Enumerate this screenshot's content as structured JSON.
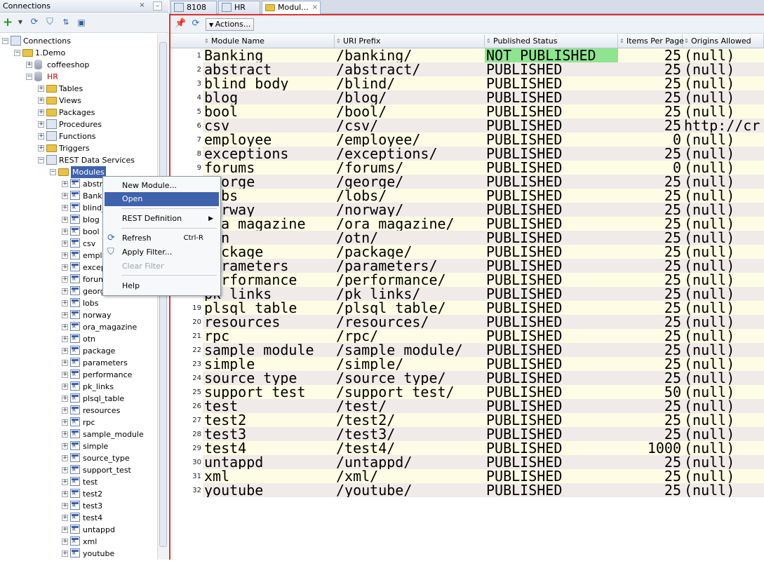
{
  "connections_panel": {
    "title": "Connections",
    "tree": [
      {
        "label": "Connections",
        "level": 0,
        "icon": "connections-icon",
        "expander": "minus"
      },
      {
        "label": "1.Demo",
        "level": 1,
        "icon": "folder-icon",
        "expander": "minus"
      },
      {
        "label": "coffeeshop",
        "level": 2,
        "icon": "database-icon",
        "expander": "plus"
      },
      {
        "label": "HR",
        "level": 2,
        "icon": "database-icon",
        "expander": "minus",
        "color": "#cc0000"
      },
      {
        "label": "Tables",
        "level": 3,
        "icon": "tables-icon",
        "expander": "plus"
      },
      {
        "label": "Views",
        "level": 3,
        "icon": "views-icon",
        "expander": "plus"
      },
      {
        "label": "Packages",
        "level": 3,
        "icon": "packages-icon",
        "expander": "plus"
      },
      {
        "label": "Procedures",
        "level": 3,
        "icon": "procedures-icon",
        "expander": "plus"
      },
      {
        "label": "Functions",
        "level": 3,
        "icon": "functions-icon",
        "expander": "plus"
      },
      {
        "label": "Triggers",
        "level": 3,
        "icon": "triggers-icon",
        "expander": "plus"
      },
      {
        "label": "REST Data Services",
        "level": 3,
        "icon": "rest-data-services-icon",
        "expander": "minus"
      },
      {
        "label": "Modules",
        "level": 4,
        "icon": "modules-icon",
        "expander": "minus",
        "selected": true
      },
      {
        "label": "abstra",
        "level": 5,
        "icon": "rest-module-icon",
        "expander": "plus"
      },
      {
        "label": "Bankir",
        "level": 5,
        "icon": "rest-module-icon",
        "expander": "plus"
      },
      {
        "label": "blind_",
        "level": 5,
        "icon": "rest-module-icon",
        "expander": "plus"
      },
      {
        "label": "blog",
        "level": 5,
        "icon": "rest-module-icon",
        "expander": "plus"
      },
      {
        "label": "bool",
        "level": 5,
        "icon": "rest-module-icon",
        "expander": "plus"
      },
      {
        "label": "csv",
        "level": 5,
        "icon": "rest-module-icon",
        "expander": "plus"
      },
      {
        "label": "emplo",
        "level": 5,
        "icon": "rest-module-icon",
        "expander": "plus"
      },
      {
        "label": "excep",
        "level": 5,
        "icon": "rest-module-icon",
        "expander": "plus"
      },
      {
        "label": "forum",
        "level": 5,
        "icon": "rest-module-icon",
        "expander": "plus"
      },
      {
        "label": "georg",
        "level": 5,
        "icon": "rest-module-icon",
        "expander": "plus"
      },
      {
        "label": "lobs",
        "level": 5,
        "icon": "rest-module-icon",
        "expander": "plus"
      },
      {
        "label": "norway",
        "level": 5,
        "icon": "rest-module-icon",
        "expander": "plus"
      },
      {
        "label": "ora_magazine",
        "level": 5,
        "icon": "rest-module-icon",
        "expander": "plus"
      },
      {
        "label": "otn",
        "level": 5,
        "icon": "rest-module-icon",
        "expander": "plus"
      },
      {
        "label": "package",
        "level": 5,
        "icon": "rest-module-icon",
        "expander": "plus"
      },
      {
        "label": "parameters",
        "level": 5,
        "icon": "rest-module-icon",
        "expander": "plus"
      },
      {
        "label": "performance",
        "level": 5,
        "icon": "rest-module-icon",
        "expander": "plus"
      },
      {
        "label": "pk_links",
        "level": 5,
        "icon": "rest-module-icon",
        "expander": "plus"
      },
      {
        "label": "plsql_table",
        "level": 5,
        "icon": "rest-module-icon",
        "expander": "plus"
      },
      {
        "label": "resources",
        "level": 5,
        "icon": "rest-module-icon",
        "expander": "plus"
      },
      {
        "label": "rpc",
        "level": 5,
        "icon": "rest-module-icon",
        "expander": "plus"
      },
      {
        "label": "sample_module",
        "level": 5,
        "icon": "rest-module-icon",
        "expander": "plus"
      },
      {
        "label": "simple",
        "level": 5,
        "icon": "rest-module-icon",
        "expander": "plus"
      },
      {
        "label": "source_type",
        "level": 5,
        "icon": "rest-module-icon",
        "expander": "plus"
      },
      {
        "label": "support_test",
        "level": 5,
        "icon": "rest-module-icon",
        "expander": "plus"
      },
      {
        "label": "test",
        "level": 5,
        "icon": "rest-module-icon",
        "expander": "plus"
      },
      {
        "label": "test2",
        "level": 5,
        "icon": "rest-module-icon",
        "expander": "plus"
      },
      {
        "label": "test3",
        "level": 5,
        "icon": "rest-module-icon",
        "expander": "plus"
      },
      {
        "label": "test4",
        "level": 5,
        "icon": "rest-module-icon",
        "expander": "plus"
      },
      {
        "label": "untappd",
        "level": 5,
        "icon": "rest-module-icon",
        "expander": "plus"
      },
      {
        "label": "xml",
        "level": 5,
        "icon": "rest-module-icon",
        "expander": "plus"
      },
      {
        "label": "youtube",
        "level": 5,
        "icon": "rest-module-icon",
        "expander": "plus"
      }
    ]
  },
  "tabs": [
    {
      "label": "8108",
      "icon": "sql-worksheet-icon",
      "active": false
    },
    {
      "label": "HR",
      "icon": "sql-worksheet-icon",
      "active": false
    },
    {
      "label": "Modul...",
      "icon": "modules-icon",
      "active": true
    }
  ],
  "editor_toolbar": {
    "actions_label": "Actions..."
  },
  "grid": {
    "columns": [
      "Module Name",
      "URI Prefix",
      "Published Status",
      "Items Per Page",
      "Origins Allowed"
    ],
    "rows": [
      {
        "n": "1",
        "name": "Banking",
        "uri": "/banking/",
        "status": "NOT PUBLISHED",
        "items": "25",
        "origins": "(null)"
      },
      {
        "n": "2",
        "name": "abstract",
        "uri": "/abstract/",
        "status": "PUBLISHED",
        "items": "25",
        "origins": "(null)"
      },
      {
        "n": "3",
        "name": "blind body",
        "uri": "/blind/",
        "status": "PUBLISHED",
        "items": "25",
        "origins": "(null)"
      },
      {
        "n": "4",
        "name": "blog",
        "uri": "/blog/",
        "status": "PUBLISHED",
        "items": "25",
        "origins": "(null)"
      },
      {
        "n": "5",
        "name": "bool",
        "uri": "/bool/",
        "status": "PUBLISHED",
        "items": "25",
        "origins": "(null)"
      },
      {
        "n": "6",
        "name": "csv",
        "uri": "/csv/",
        "status": "PUBLISHED",
        "items": "25",
        "origins": "http://cr"
      },
      {
        "n": "7",
        "name": "employee",
        "uri": "/employee/",
        "status": "PUBLISHED",
        "items": "0",
        "origins": "(null)"
      },
      {
        "n": "8",
        "name": "exceptions",
        "uri": "/exceptions/",
        "status": "PUBLISHED",
        "items": "25",
        "origins": "(null)"
      },
      {
        "n": "9",
        "name": "forums",
        "uri": "/forums/",
        "status": "PUBLISHED",
        "items": "0",
        "origins": "(null)"
      },
      {
        "n": "10",
        "name": "george",
        "uri": "/george/",
        "status": "PUBLISHED",
        "items": "25",
        "origins": "(null)"
      },
      {
        "n": "11",
        "name": "lobs",
        "uri": "/lobs/",
        "status": "PUBLISHED",
        "items": "25",
        "origins": "(null)"
      },
      {
        "n": "12",
        "name": "norway",
        "uri": "/norway/",
        "status": "PUBLISHED",
        "items": "25",
        "origins": "(null)"
      },
      {
        "n": "13",
        "name": "ora magazine",
        "uri": "/ora magazine/",
        "status": "PUBLISHED",
        "items": "25",
        "origins": "(null)"
      },
      {
        "n": "14",
        "name": "otn",
        "uri": "/otn/",
        "status": "PUBLISHED",
        "items": "25",
        "origins": "(null)"
      },
      {
        "n": "15",
        "name": "package",
        "uri": "/package/",
        "status": "PUBLISHED",
        "items": "25",
        "origins": "(null)"
      },
      {
        "n": "16",
        "name": "parameters",
        "uri": "/parameters/",
        "status": "PUBLISHED",
        "items": "25",
        "origins": "(null)"
      },
      {
        "n": "17",
        "name": "performance",
        "uri": "/performance/",
        "status": "PUBLISHED",
        "items": "25",
        "origins": "(null)"
      },
      {
        "n": "18",
        "name": "pk links",
        "uri": "/pk links/",
        "status": "PUBLISHED",
        "items": "25",
        "origins": "(null)"
      },
      {
        "n": "19",
        "name": "plsql table",
        "uri": "/plsql table/",
        "status": "PUBLISHED",
        "items": "25",
        "origins": "(null)"
      },
      {
        "n": "20",
        "name": "resources",
        "uri": "/resources/",
        "status": "PUBLISHED",
        "items": "25",
        "origins": "(null)"
      },
      {
        "n": "21",
        "name": "rpc",
        "uri": "/rpc/",
        "status": "PUBLISHED",
        "items": "25",
        "origins": "(null)"
      },
      {
        "n": "22",
        "name": "sample module",
        "uri": "/sample module/",
        "status": "PUBLISHED",
        "items": "25",
        "origins": "(null)"
      },
      {
        "n": "23",
        "name": "simple",
        "uri": "/simple/",
        "status": "PUBLISHED",
        "items": "25",
        "origins": "(null)"
      },
      {
        "n": "24",
        "name": "source type",
        "uri": "/source type/",
        "status": "PUBLISHED",
        "items": "25",
        "origins": "(null)"
      },
      {
        "n": "25",
        "name": "support test",
        "uri": "/support test/",
        "status": "PUBLISHED",
        "items": "50",
        "origins": "(null)"
      },
      {
        "n": "26",
        "name": "test",
        "uri": "/test/",
        "status": "PUBLISHED",
        "items": "25",
        "origins": "(null)"
      },
      {
        "n": "27",
        "name": "test2",
        "uri": "/test2/",
        "status": "PUBLISHED",
        "items": "25",
        "origins": "(null)"
      },
      {
        "n": "28",
        "name": "test3",
        "uri": "/test3/",
        "status": "PUBLISHED",
        "items": "25",
        "origins": "(null)"
      },
      {
        "n": "29",
        "name": "test4",
        "uri": "/test4/",
        "status": "PUBLISHED",
        "items": "1000",
        "origins": "(null)"
      },
      {
        "n": "30",
        "name": "untappd",
        "uri": "/untappd/",
        "status": "PUBLISHED",
        "items": "25",
        "origins": "(null)"
      },
      {
        "n": "31",
        "name": "xml",
        "uri": "/xml/",
        "status": "PUBLISHED",
        "items": "25",
        "origins": "(null)"
      },
      {
        "n": "32",
        "name": "youtube",
        "uri": "/youtube/",
        "status": "PUBLISHED",
        "items": "25",
        "origins": "(null)"
      }
    ]
  },
  "context_menu": {
    "items": [
      {
        "label": "New Module...",
        "enabled": true
      },
      {
        "label": "Open",
        "enabled": true,
        "selected": true
      },
      {
        "label": "REST Definition",
        "enabled": true,
        "submenu": true
      },
      {
        "label": "Refresh",
        "enabled": true,
        "shortcut": "Ctrl-R",
        "icon": "refresh-icon"
      },
      {
        "label": "Apply Filter...",
        "enabled": true,
        "icon": "filter-icon"
      },
      {
        "label": "Clear Filter",
        "enabled": false
      },
      {
        "label": "Help",
        "enabled": true
      }
    ]
  },
  "colors": {
    "accent": "#3f62ad",
    "not_published": "#8fe58f",
    "editor_border": "#e03030",
    "hr_label": "#cc0000"
  }
}
